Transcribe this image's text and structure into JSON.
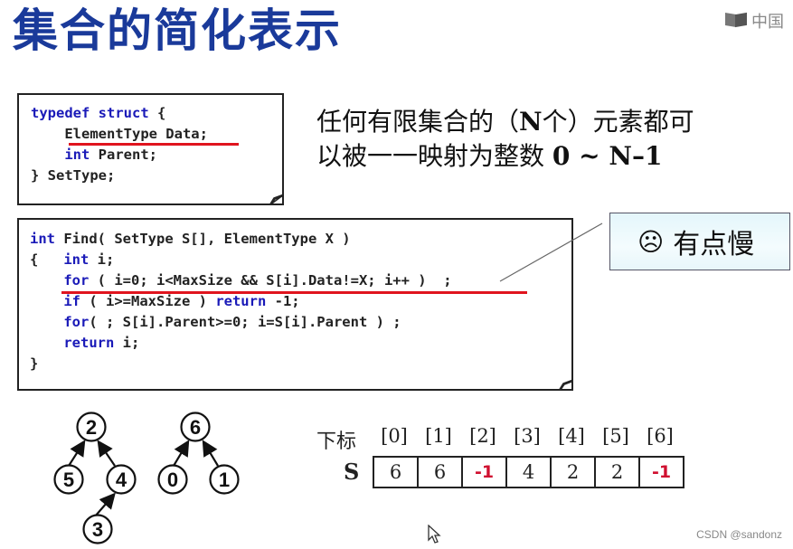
{
  "slide": {
    "title": "集合的简化表示",
    "logo_text": "中国"
  },
  "struct_code": {
    "lines": [
      [
        {
          "t": "typedef struct",
          "k": true
        },
        {
          "t": " {",
          "k": false
        }
      ],
      [
        {
          "t": "    ElementType Data;",
          "k": false
        }
      ],
      [
        {
          "t": "    ",
          "k": false
        },
        {
          "t": "int",
          "k": true
        },
        {
          "t": " Parent;",
          "k": false
        }
      ],
      [
        {
          "t": "} SetType;",
          "k": false
        }
      ]
    ]
  },
  "description": {
    "line1_a": "任何有限集合的（",
    "line1_b": "N",
    "line1_c": "个）元素都可",
    "line2_a": "以被一一映射为整数 ",
    "line2_b": "0 ~ N–1"
  },
  "find_code": {
    "lines": [
      [
        {
          "t": "int",
          "k": true
        },
        {
          "t": " Find( SetType S[], ElementType X )",
          "k": false
        }
      ],
      [
        {
          "t": "{   ",
          "k": false
        },
        {
          "t": "int",
          "k": true
        },
        {
          "t": " i;",
          "k": false
        }
      ],
      [
        {
          "t": "    ",
          "k": false
        },
        {
          "t": "for",
          "k": true
        },
        {
          "t": " ( i=0; i<MaxSize && S[i].Data!=X; i++ )  ;",
          "k": false
        }
      ],
      [
        {
          "t": "    ",
          "k": false
        },
        {
          "t": "if",
          "k": true
        },
        {
          "t": " ( i>=MaxSize ) ",
          "k": false
        },
        {
          "t": "return",
          "k": true
        },
        {
          "t": " -1;",
          "k": false
        }
      ],
      [
        {
          "t": "    ",
          "k": false
        },
        {
          "t": "for",
          "k": true
        },
        {
          "t": "( ; S[i].Parent>=0; i=S[i].Parent ) ;",
          "k": false
        }
      ],
      [
        {
          "t": "    ",
          "k": false
        },
        {
          "t": "return",
          "k": true
        },
        {
          "t": " i;",
          "k": false
        }
      ],
      [
        {
          "t": "}",
          "k": false
        }
      ]
    ]
  },
  "callout": {
    "icon": "frown-face-icon",
    "face": "☹",
    "text": "有点慢"
  },
  "trees": {
    "nodes": [
      "2",
      "5",
      "4",
      "3",
      "6",
      "0",
      "1"
    ]
  },
  "array_table": {
    "index_label": "下标",
    "row_label": "S",
    "indices": [
      "[0]",
      "[1]",
      "[2]",
      "[3]",
      "[4]",
      "[5]",
      "[6]"
    ],
    "values": [
      "6",
      "6",
      "-1",
      "4",
      "2",
      "2",
      "-1"
    ],
    "root_color": "#d01030"
  },
  "watermark": "CSDN @sandonz"
}
